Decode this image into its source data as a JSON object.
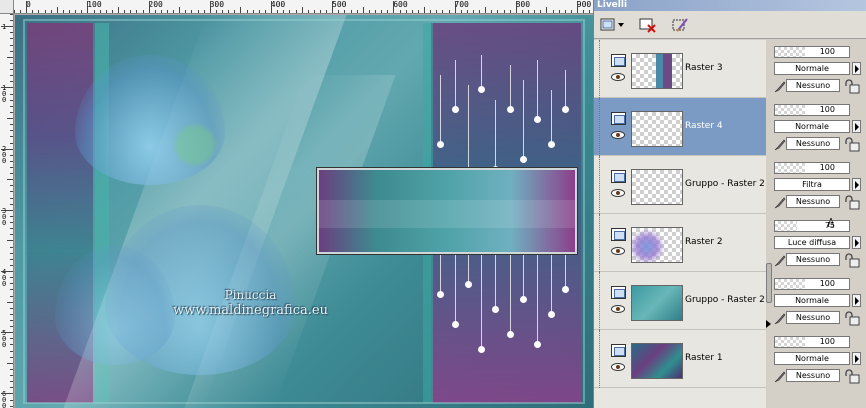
{
  "panel": {
    "title": "Livelli"
  },
  "watermark": {
    "name": "Pinuccia",
    "url": "www.maldinegrafica.eu"
  },
  "ruler": {
    "top_labels": [
      "0",
      "100",
      "200",
      "300",
      "400",
      "500",
      "600",
      "700",
      "800",
      "900"
    ],
    "left_labels": [
      "1",
      "100",
      "200",
      "300",
      "400",
      "500",
      "600"
    ]
  },
  "toolbar": {
    "new_layer_icon": "new-raster-layer-icon",
    "delete_icon": "delete-layer-icon",
    "edit_icon": "edit-selection-icon"
  },
  "layers": [
    {
      "name": "Raster 3",
      "opacity": "100",
      "blend": "Normale",
      "mask": "Nessuno",
      "selected": false,
      "opacity_fraction": 1.0,
      "thumb": "raster3"
    },
    {
      "name": "Raster 4",
      "opacity": "100",
      "blend": "Normale",
      "mask": "Nessuno",
      "selected": true,
      "opacity_fraction": 1.0,
      "thumb": "empty"
    },
    {
      "name": "Gruppo - Raster 2",
      "opacity": "100",
      "blend": "Filtra",
      "mask": "Nessuno",
      "selected": false,
      "opacity_fraction": 1.0,
      "thumb": "empty"
    },
    {
      "name": "Raster 2",
      "opacity": "75",
      "blend": "Luce diffusa",
      "mask": "Nessuno",
      "selected": false,
      "opacity_fraction": 0.75,
      "thumb": "raster2"
    },
    {
      "name": "Gruppo - Raster 2",
      "opacity": "100",
      "blend": "Normale",
      "mask": "Nessuno",
      "selected": false,
      "opacity_fraction": 1.0,
      "thumb": "gruppo2"
    },
    {
      "name": "Raster 1",
      "opacity": "100",
      "blend": "Normale",
      "mask": "Nessuno",
      "selected": false,
      "opacity_fraction": 1.0,
      "thumb": "raster1"
    }
  ]
}
